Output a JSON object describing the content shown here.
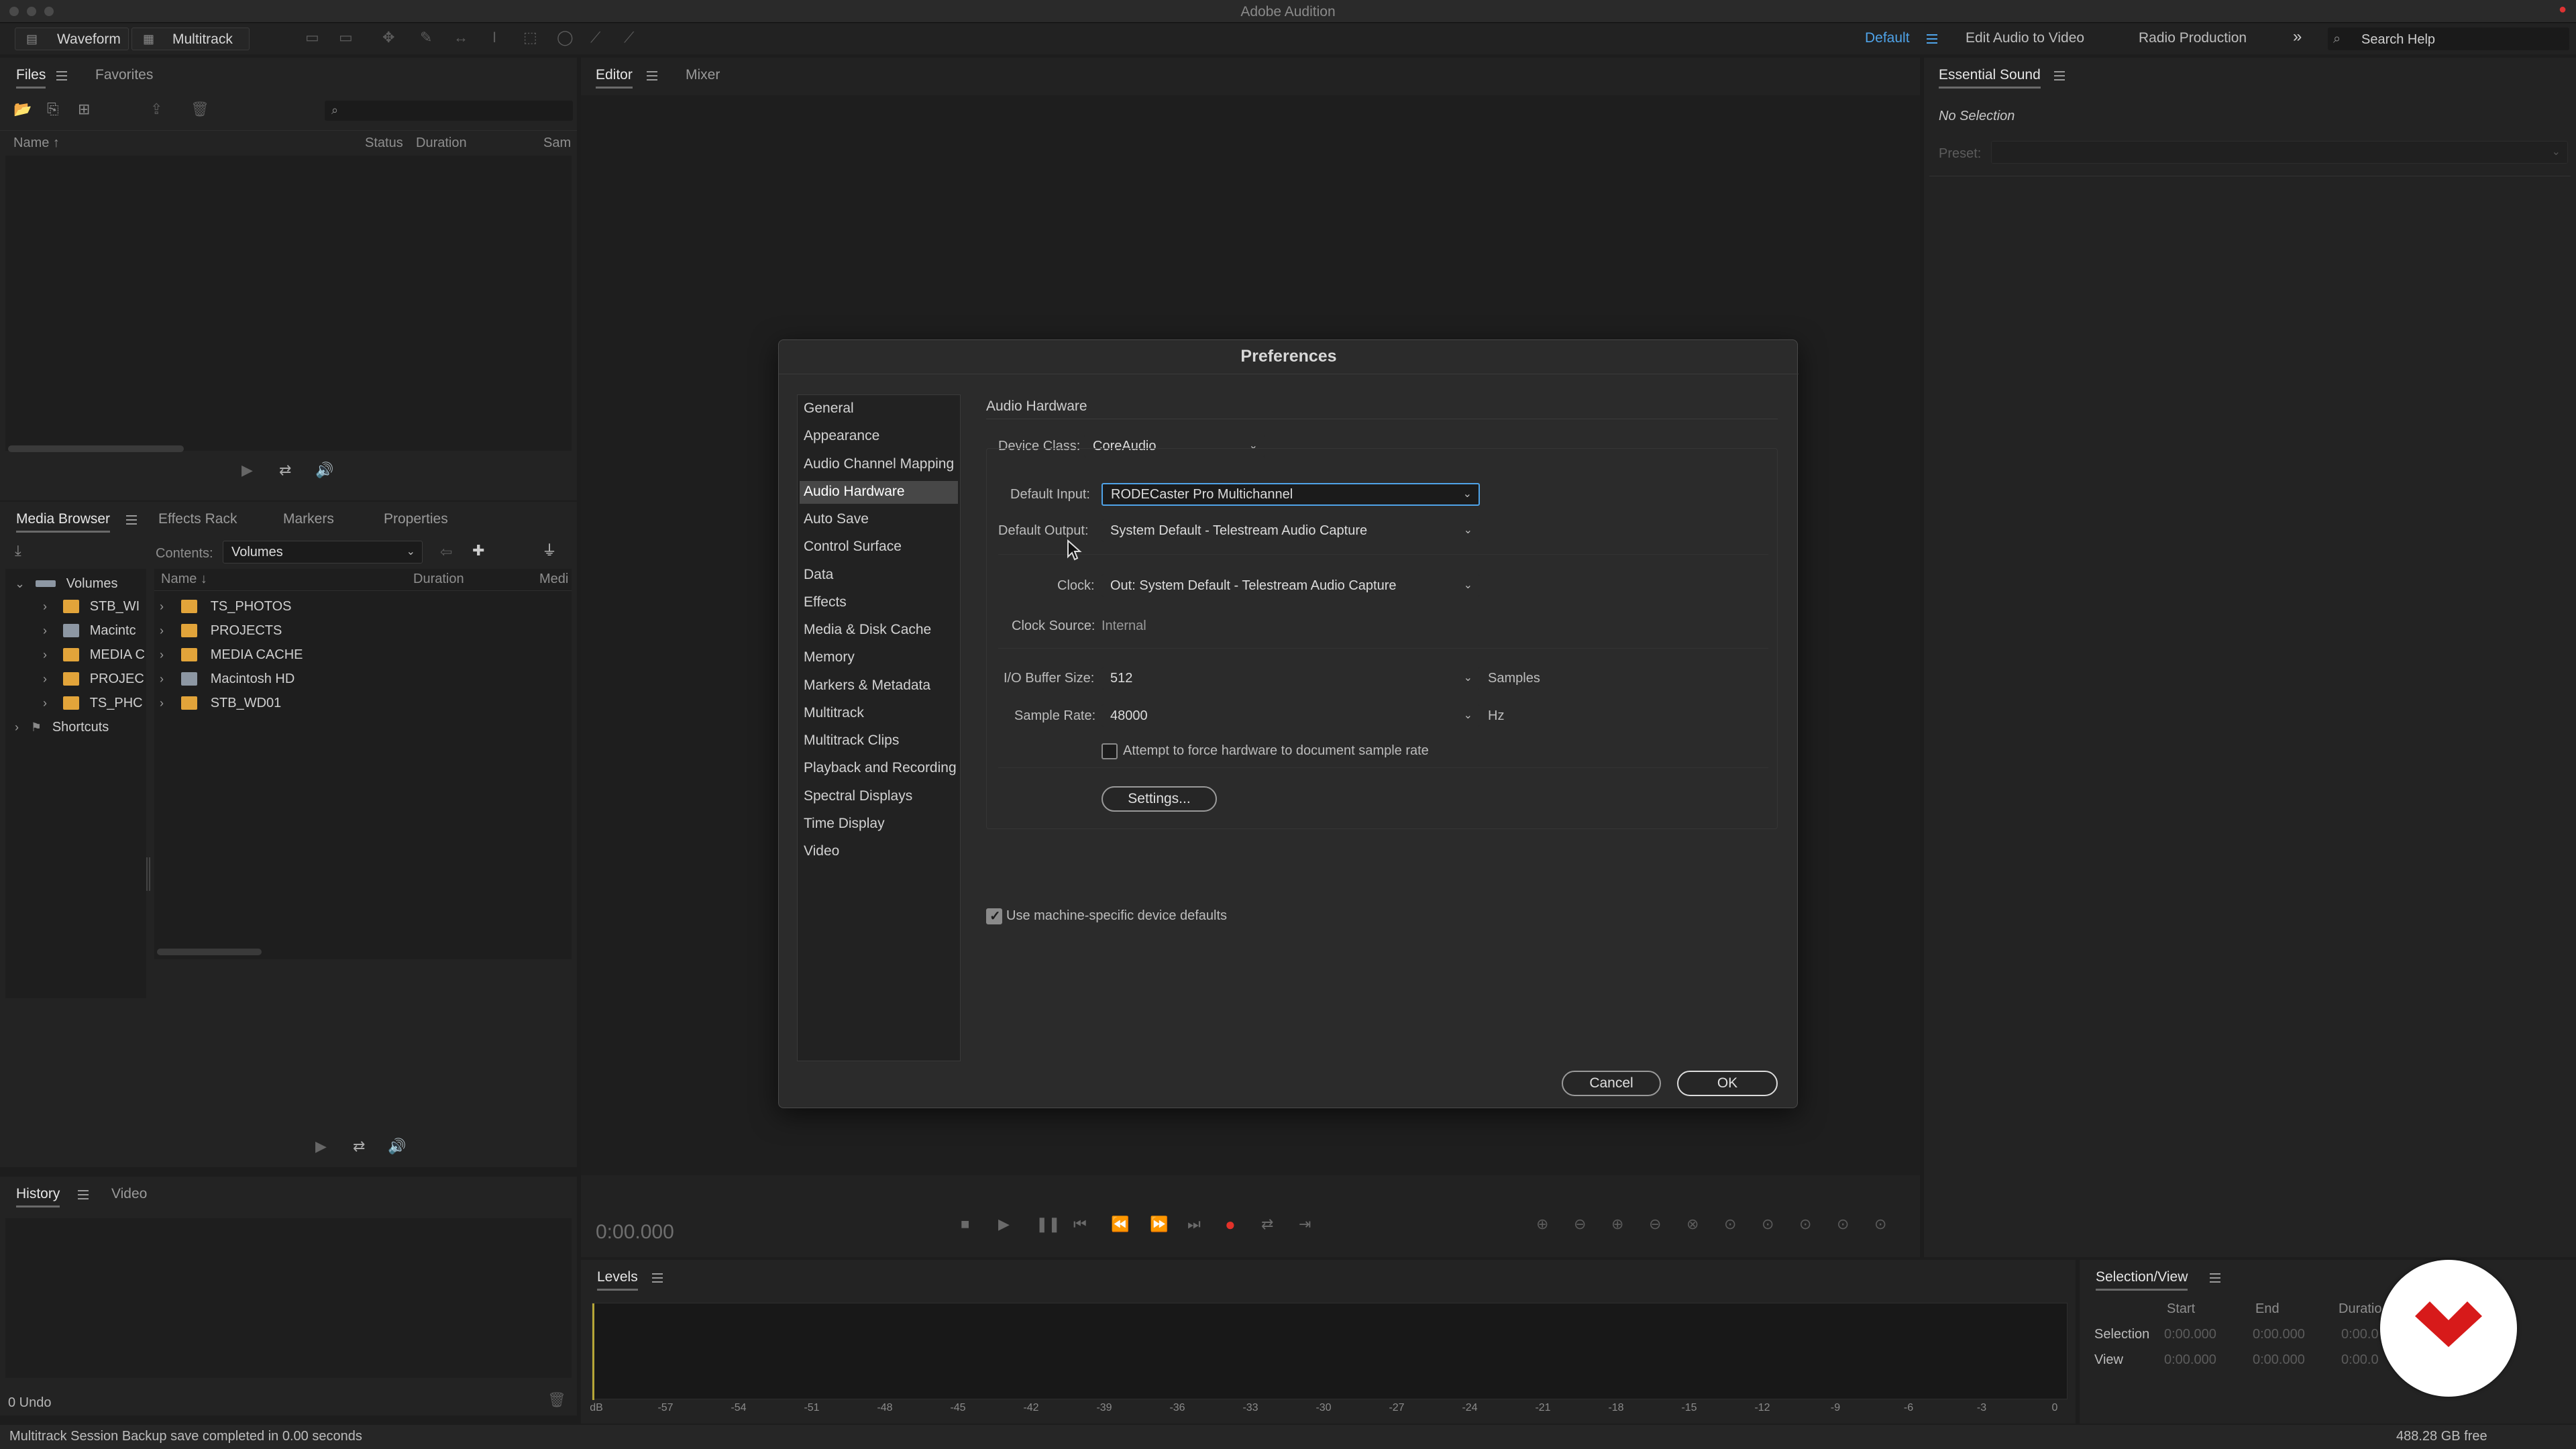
{
  "app": {
    "title": "Adobe Audition"
  },
  "toolbar": {
    "waveform_label": "Waveform",
    "multitrack_label": "Multitrack",
    "workspaces": [
      "Default",
      "Edit Audio to Video",
      "Radio Production"
    ],
    "search_placeholder": "Search Help"
  },
  "files_panel": {
    "tabs": [
      "Files",
      "Favorites"
    ],
    "columns": [
      "Name ↑",
      "Status",
      "Duration",
      "Sam"
    ]
  },
  "media_browser": {
    "tabs": [
      "Media Browser",
      "Effects Rack",
      "Markers",
      "Properties"
    ],
    "contents_label": "Contents:",
    "contents_value": "Volumes",
    "tree": [
      {
        "label": "Volumes"
      },
      {
        "label": "STB_WI"
      },
      {
        "label": "Macintc"
      },
      {
        "label": "MEDIA C"
      },
      {
        "label": "PROJEC"
      },
      {
        "label": "TS_PHC"
      },
      {
        "label": "Shortcuts"
      }
    ],
    "columns": [
      "Name ↓",
      "Duration",
      "Medi"
    ],
    "items": [
      "TS_PHOTOS",
      "PROJECTS",
      "MEDIA CACHE",
      "Macintosh HD",
      "STB_WD01"
    ]
  },
  "history_panel": {
    "tabs": [
      "History",
      "Video"
    ],
    "undo_label": "0 Undo"
  },
  "status_bar": {
    "message": "Multitrack Session Backup save completed in 0.00 seconds",
    "free_space": "488.28 GB free"
  },
  "editor": {
    "tabs": [
      "Editor",
      "Mixer"
    ],
    "time": "0:00.000"
  },
  "essential_sound": {
    "title": "Essential Sound",
    "no_selection": "No Selection",
    "preset_label": "Preset:"
  },
  "levels": {
    "title": "Levels",
    "ticks": [
      "dB",
      "-57",
      "-54",
      "-51",
      "-48",
      "-45",
      "-42",
      "-39",
      "-36",
      "-33",
      "-30",
      "-27",
      "-24",
      "-21",
      "-18",
      "-15",
      "-12",
      "-9",
      "-6",
      "-3",
      "0"
    ]
  },
  "selection_view": {
    "title": "Selection/View",
    "columns": [
      "Start",
      "End",
      "Duratio"
    ],
    "rows": [
      {
        "label": "Selection",
        "start": "0:00.000",
        "end": "0:00.000",
        "duration": "0:00.0"
      },
      {
        "label": "View",
        "start": "0:00.000",
        "end": "0:00.000",
        "duration": "0:00.0"
      }
    ]
  },
  "preferences": {
    "title": "Preferences",
    "categories": [
      "General",
      "Appearance",
      "Audio Channel Mapping",
      "Audio Hardware",
      "Auto Save",
      "Control Surface",
      "Data",
      "Effects",
      "Media & Disk Cache",
      "Memory",
      "Markers & Metadata",
      "Multitrack",
      "Multitrack Clips",
      "Playback and Recording",
      "Spectral Displays",
      "Time Display",
      "Video"
    ],
    "selected_category": "Audio Hardware",
    "section_title": "Audio Hardware",
    "device_class_label": "Device Class:",
    "device_class_value": "CoreAudio",
    "default_input_label": "Default Input:",
    "default_input_value": "RODECaster Pro Multichannel",
    "default_output_label": "Default Output:",
    "default_output_value": "System Default - Telestream Audio Capture",
    "clock_label": "Clock:",
    "clock_value": "Out: System Default - Telestream Audio Capture",
    "clock_source_label": "Clock Source:",
    "clock_source_value": "Internal",
    "buffer_label": "I/O Buffer Size:",
    "buffer_value": "512",
    "buffer_unit": "Samples",
    "sample_rate_label": "Sample Rate:",
    "sample_rate_value": "48000",
    "sample_rate_unit": "Hz",
    "force_rate_label": "Attempt to force hardware to document sample rate",
    "force_rate_checked": false,
    "settings_button": "Settings...",
    "machine_defaults_label": "Use machine-specific device defaults",
    "machine_defaults_checked": true,
    "cancel_button": "Cancel",
    "ok_button": "OK"
  }
}
